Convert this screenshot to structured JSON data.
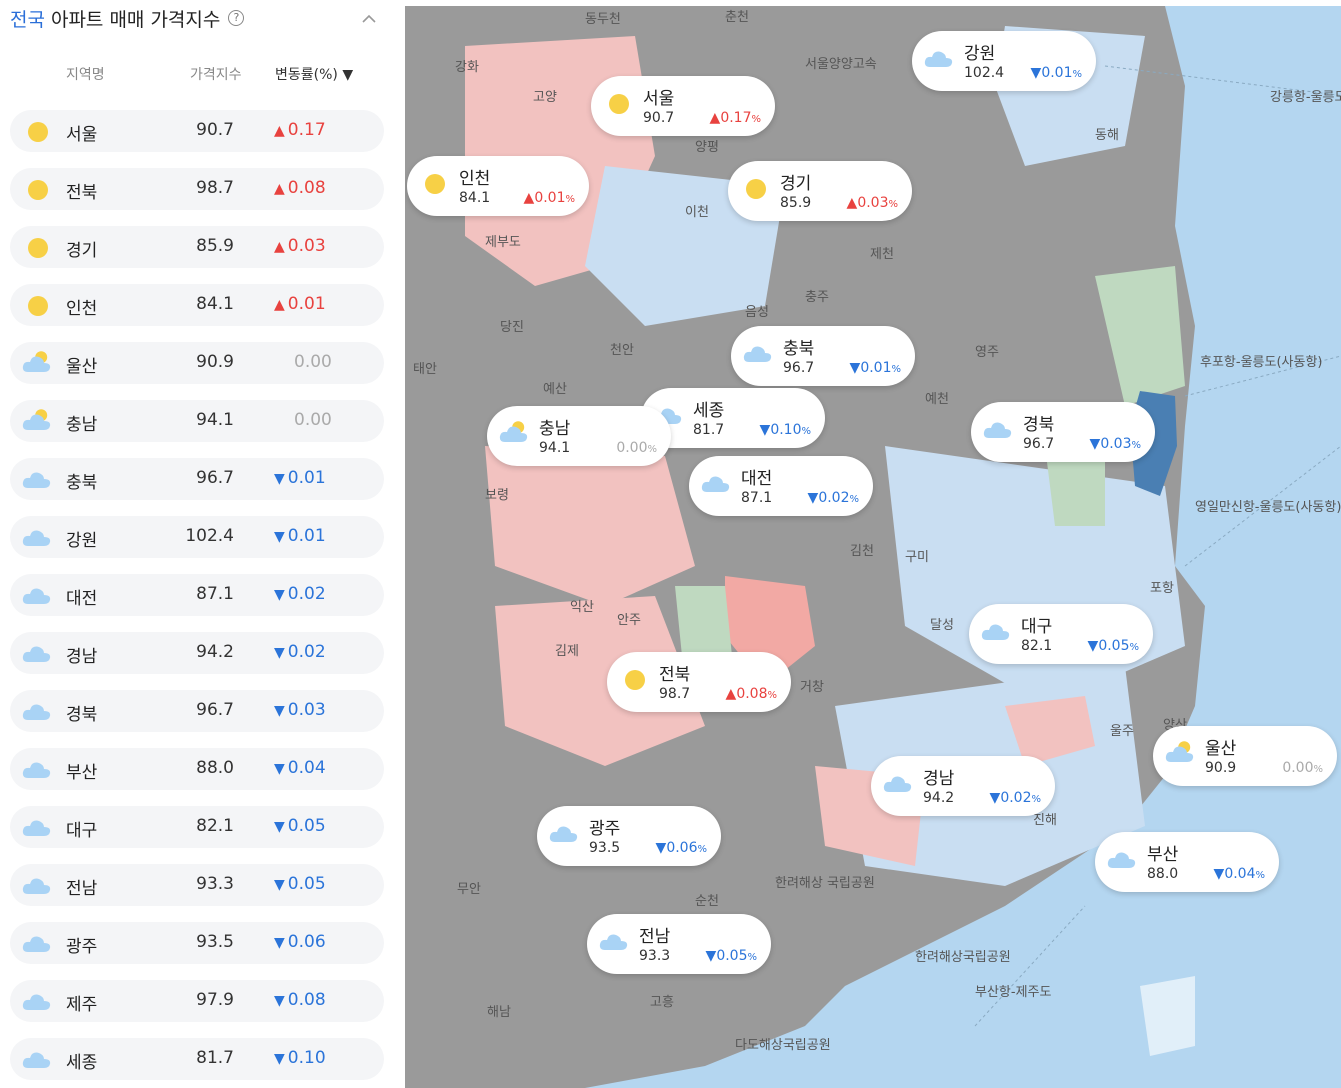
{
  "header": {
    "scope": "전국",
    "title": "아파트 매매 가격지수",
    "help_icon": "?"
  },
  "columns": {
    "region": "지역명",
    "index": "가격지수",
    "change": "변동률(%) ▼"
  },
  "rows": [
    {
      "name": "서울",
      "index": "90.7",
      "change": "0.17",
      "dir": "up",
      "icon": "sun-icon"
    },
    {
      "name": "전북",
      "index": "98.7",
      "change": "0.08",
      "dir": "up",
      "icon": "sun-icon"
    },
    {
      "name": "경기",
      "index": "85.9",
      "change": "0.03",
      "dir": "up",
      "icon": "sun-icon"
    },
    {
      "name": "인천",
      "index": "84.1",
      "change": "0.01",
      "dir": "up",
      "icon": "sun-icon"
    },
    {
      "name": "울산",
      "index": "90.9",
      "change": "0.00",
      "dir": "flat",
      "icon": "partly-cloudy-icon"
    },
    {
      "name": "충남",
      "index": "94.1",
      "change": "0.00",
      "dir": "flat",
      "icon": "partly-cloudy-icon"
    },
    {
      "name": "충북",
      "index": "96.7",
      "change": "0.01",
      "dir": "down",
      "icon": "cloud-icon"
    },
    {
      "name": "강원",
      "index": "102.4",
      "change": "0.01",
      "dir": "down",
      "icon": "cloud-icon"
    },
    {
      "name": "대전",
      "index": "87.1",
      "change": "0.02",
      "dir": "down",
      "icon": "cloud-icon"
    },
    {
      "name": "경남",
      "index": "94.2",
      "change": "0.02",
      "dir": "down",
      "icon": "cloud-icon"
    },
    {
      "name": "경북",
      "index": "96.7",
      "change": "0.03",
      "dir": "down",
      "icon": "cloud-icon"
    },
    {
      "name": "부산",
      "index": "88.0",
      "change": "0.04",
      "dir": "down",
      "icon": "cloud-icon"
    },
    {
      "name": "대구",
      "index": "82.1",
      "change": "0.05",
      "dir": "down",
      "icon": "cloud-icon"
    },
    {
      "name": "전남",
      "index": "93.3",
      "change": "0.05",
      "dir": "down",
      "icon": "cloud-icon"
    },
    {
      "name": "광주",
      "index": "93.5",
      "change": "0.06",
      "dir": "down",
      "icon": "cloud-icon"
    },
    {
      "name": "제주",
      "index": "97.9",
      "change": "0.08",
      "dir": "down",
      "icon": "cloud-icon"
    },
    {
      "name": "세종",
      "index": "81.7",
      "change": "0.10",
      "dir": "down",
      "icon": "cloud-icon"
    }
  ],
  "cards": [
    {
      "name": "강원",
      "index": "102.4",
      "change": "0.01",
      "dir": "down",
      "icon": "cloud-icon"
    },
    {
      "name": "서울",
      "index": "90.7",
      "change": "0.17",
      "dir": "up",
      "icon": "sun-icon"
    },
    {
      "name": "인천",
      "index": "84.1",
      "change": "0.01",
      "dir": "up",
      "icon": "sun-icon"
    },
    {
      "name": "경기",
      "index": "85.9",
      "change": "0.03",
      "dir": "up",
      "icon": "sun-icon"
    },
    {
      "name": "충북",
      "index": "96.7",
      "change": "0.01",
      "dir": "down",
      "icon": "cloud-icon"
    },
    {
      "name": "세종",
      "index": "81.7",
      "change": "0.10",
      "dir": "down",
      "icon": "cloud-icon"
    },
    {
      "name": "충남",
      "index": "94.1",
      "change": "0.00",
      "dir": "flat",
      "icon": "partly-cloudy-icon"
    },
    {
      "name": "경북",
      "index": "96.7",
      "change": "0.03",
      "dir": "down",
      "icon": "cloud-icon"
    },
    {
      "name": "대전",
      "index": "87.1",
      "change": "0.02",
      "dir": "down",
      "icon": "cloud-icon"
    },
    {
      "name": "대구",
      "index": "82.1",
      "change": "0.05",
      "dir": "down",
      "icon": "cloud-icon"
    },
    {
      "name": "전북",
      "index": "98.7",
      "change": "0.08",
      "dir": "up",
      "icon": "sun-icon"
    },
    {
      "name": "울산",
      "index": "90.9",
      "change": "0.00",
      "dir": "flat",
      "icon": "partly-cloudy-icon"
    },
    {
      "name": "경남",
      "index": "94.2",
      "change": "0.02",
      "dir": "down",
      "icon": "cloud-icon"
    },
    {
      "name": "광주",
      "index": "93.5",
      "change": "0.06",
      "dir": "down",
      "icon": "cloud-icon"
    },
    {
      "name": "부산",
      "index": "88.0",
      "change": "0.04",
      "dir": "down",
      "icon": "cloud-icon"
    },
    {
      "name": "전남",
      "index": "93.3",
      "change": "0.05",
      "dir": "down",
      "icon": "cloud-icon"
    }
  ],
  "map_labels": [
    "춘천",
    "동두천",
    "강화",
    "고양",
    "서울양양고속",
    "동해",
    "강릉항-울릉도",
    "양평",
    "이천",
    "제부도",
    "당진",
    "음성",
    "충주",
    "제천",
    "영주",
    "태안",
    "예산",
    "천안",
    "예천",
    "후포항-울릉도(사동항)",
    "보령",
    "익산",
    "안주",
    "김천",
    "구미",
    "달성",
    "포항",
    "김제",
    "거창",
    "영일만신항-울릉도(사동항)",
    "무안",
    "순천",
    "한려해상 국립공원",
    "해남",
    "고흥",
    "다도해상국립공원",
    "부산항-제주도",
    "울주",
    "양산",
    "진해",
    "한려해상국립공원"
  ],
  "unit_suffix": "%",
  "colors": {
    "up": "#e8423f",
    "down": "#2b74d9",
    "flat": "#aaaaaa",
    "accent": "#2b6fd8",
    "sea": "#b4d6f0"
  }
}
